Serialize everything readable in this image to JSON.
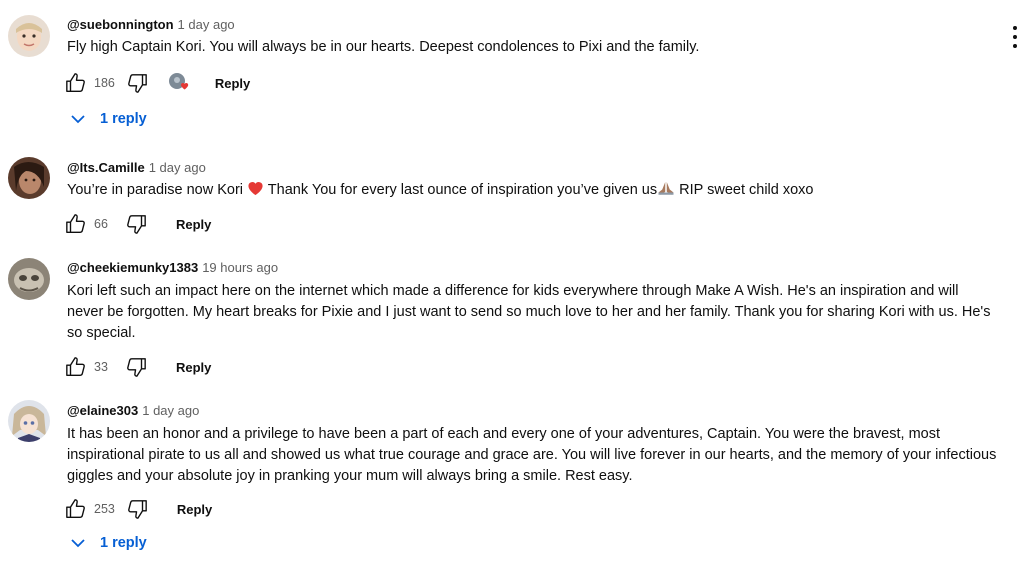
{
  "comments": [
    {
      "author": "@suebonnington",
      "time": "1 day ago",
      "text": "Fly high Captain Kori. You will always be in our hearts. Deepest condolences to Pixi and the family.",
      "likes": "186",
      "reply_label": "Reply",
      "replies_label": "1 reply"
    },
    {
      "author": "@Its.Camille",
      "time": "1 day ago",
      "text_a": "You’re in paradise now Kori",
      "text_b": " Thank You for every last ounce of inspiration you’ve given us",
      "text_c": " RIP sweet child xoxo",
      "likes": "66",
      "reply_label": "Reply"
    },
    {
      "author": "@cheekiemunky1383",
      "time": "19 hours ago",
      "text": "Kori left such an impact here on the internet which made a difference for kids everywhere through Make A Wish. He's an inspiration and will never be forgotten. My heart breaks for Pixie and I just want to send so much love to her and her family. Thank you for sharing Kori with us. He's so special.",
      "likes": "33",
      "reply_label": "Reply"
    },
    {
      "author": "@elaine303",
      "time": "1 day ago",
      "text": "It has been an honor and a privilege to have been a part of each and every one of your adventures, Captain. You were the bravest, most inspirational pirate to us all and showed us what true courage and grace are. You will live forever in our hearts, and the memory of your infectious giggles and your absolute joy in pranking your mum will always bring a smile. Rest easy.",
      "likes": "253",
      "reply_label": "Reply",
      "replies_label": "1 reply"
    }
  ],
  "colors": {
    "link": "#065fd4",
    "muted": "#606060",
    "text": "#0f0f0f",
    "heart": "#e53935"
  },
  "icons": [
    "thumb-up-icon",
    "thumb-down-icon",
    "creator-heart-icon",
    "chevron-down-icon",
    "more-vert-icon",
    "red-heart-emoji",
    "praying-hands-emoji"
  ]
}
